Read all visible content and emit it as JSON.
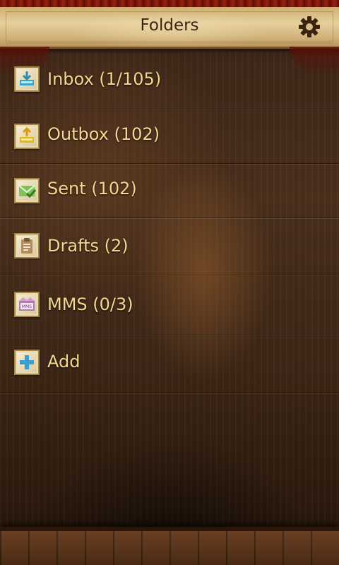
{
  "header": {
    "title": "Folders",
    "settings_icon": "gear-icon"
  },
  "folders": [
    {
      "label": "Inbox (1/105)",
      "icon": "inbox-download-icon"
    },
    {
      "label": "Outbox (102)",
      "icon": "outbox-upload-icon"
    },
    {
      "label": "Sent (102)",
      "icon": "sent-envelope-check-icon"
    },
    {
      "label": "Drafts (2)",
      "icon": "clipboard-drafts-icon"
    },
    {
      "label": "MMS (0/3)",
      "icon": "mms-envelope-icon"
    },
    {
      "label": "Add",
      "icon": "plus-icon"
    }
  ],
  "mms_icon_text": "MMS",
  "colors": {
    "header_bg": "#e3c996",
    "header_text": "#3a2410",
    "label_text": "#f4d890",
    "background": "#3d2616"
  }
}
